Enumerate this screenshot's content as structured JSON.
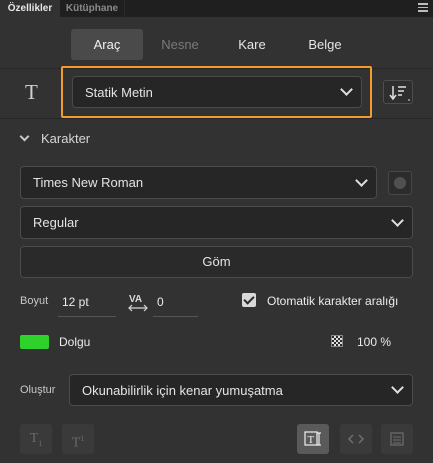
{
  "panel_tabs": {
    "active": "Özellikler",
    "inactive": "Kütüphane"
  },
  "segments": {
    "tool": "Araç",
    "object": "Nesne",
    "frame": "Kare",
    "document": "Belge"
  },
  "text_type": {
    "value": "Statik Metin"
  },
  "character": {
    "title": "Karakter",
    "font_family": "Times New Roman",
    "font_style": "Regular",
    "embed_label": "Göm",
    "size_label": "Boyut",
    "size_value": "12 pt",
    "tracking_value": "0",
    "auto_kern_label": "Otomatik karakter aralığı",
    "auto_kern_checked": true,
    "fill_label": "Dolgu",
    "fill_color": "#2fd12b",
    "alpha_value": "100 %"
  },
  "render": {
    "label": "Oluştur",
    "value": "Okunabilirlik için kenar yumuşatma"
  },
  "colors": {
    "highlight": "#f39c2b",
    "panel_bg": "#323232"
  }
}
